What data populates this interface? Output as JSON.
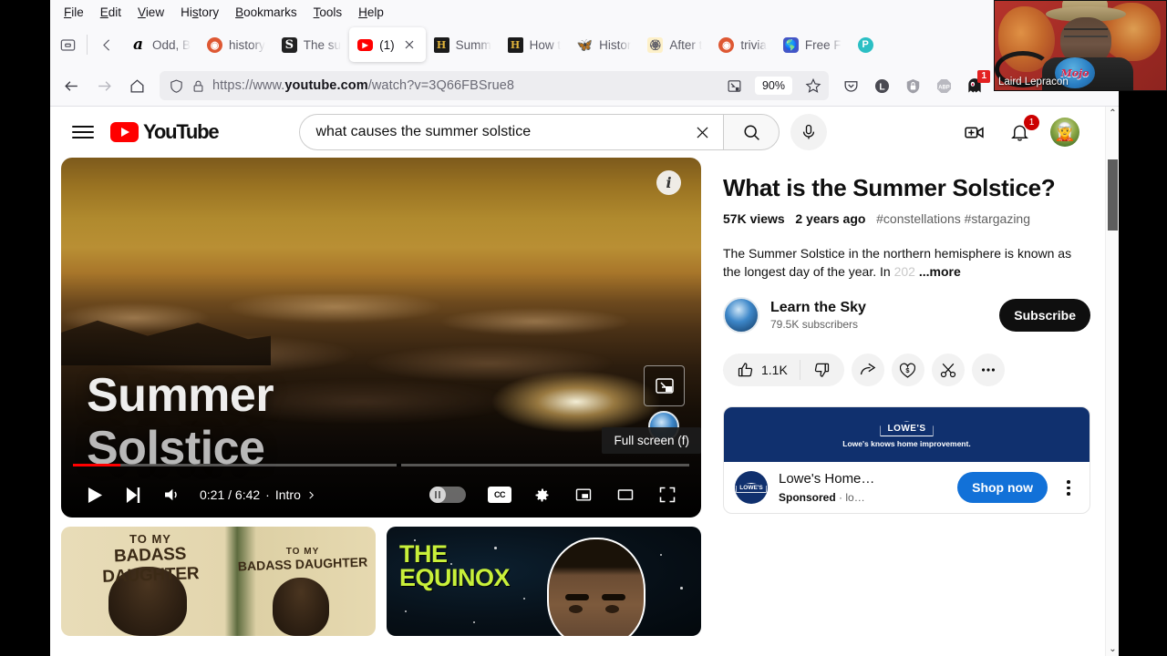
{
  "browser": {
    "menu_items": [
      "File",
      "Edit",
      "View",
      "History",
      "Bookmarks",
      "Tools",
      "Help"
    ],
    "tabs": [
      {
        "label": "Odd, B",
        "icon": "amazon-icon",
        "active": false
      },
      {
        "label": "history",
        "icon": "duckduckgo-icon",
        "active": false
      },
      {
        "label": "The su",
        "icon": "scribd-icon",
        "active": false
      },
      {
        "label": "(1)",
        "icon": "youtube-icon",
        "active": true
      },
      {
        "label": "Summ",
        "icon": "history-channel-icon",
        "active": false
      },
      {
        "label": "How t",
        "icon": "history-channel-icon",
        "active": false
      },
      {
        "label": "Histor",
        "icon": "butterfly-icon",
        "active": false
      },
      {
        "label": "After t",
        "icon": "afterlife-icon",
        "active": false
      },
      {
        "label": "trivia",
        "icon": "duckduckgo-icon",
        "active": false
      },
      {
        "label": "Free F",
        "icon": "globe-icon",
        "active": false
      },
      {
        "label": "",
        "icon": "p-icon",
        "active": false
      }
    ],
    "url": "https://www.youtube.com/watch?v=3Q66FBSrue8",
    "url_domain": "youtube.com",
    "url_prefix": "https://www.",
    "url_suffix": "/watch?v=3Q66FBSrue8",
    "zoom_level": "90%",
    "extension_badge_count": "1",
    "extensions": [
      "pocket-icon",
      "lastpass-icon",
      "privacy-badger-icon",
      "abp-icon",
      "ghostery-icon",
      "shoe-icon",
      "puzzle-extensions-icon",
      "overflow-chevrons-icon",
      "app-menu-icon"
    ]
  },
  "webcam": {
    "name": "Laird Lepracon"
  },
  "youtube": {
    "logo_text": "YouTube",
    "search": {
      "value": "what causes the summer solstice",
      "placeholder": "Search"
    },
    "notification_count": "1",
    "header_icons": [
      "guide-menu-icon",
      "voice-search-icon",
      "create-video-icon",
      "notifications-bell-icon",
      "account-avatar"
    ]
  },
  "player": {
    "title_line1": "Summer",
    "title_line2": "Solstice",
    "current_time": "0:21",
    "duration": "6:42",
    "separator": "·",
    "chapter": "Intro",
    "tooltip": "Full screen (f)",
    "time_display": "0:21 / 6:42",
    "controls": [
      "play-button",
      "next-button",
      "volume-button",
      "autoplay-toggle",
      "subtitles-button",
      "settings-button",
      "miniplayer-button",
      "theater-button",
      "fullscreen-button"
    ],
    "cc_label": "CC",
    "progress_percent": 5.2
  },
  "video": {
    "title": "What is the Summer Solstice?",
    "views": "57K views",
    "age": "2 years ago",
    "tags": "#constellations #stargazing",
    "description_line1": "The Summer Solstice in the northern hemisphere is",
    "description_line2": "known as the longest day of the year. In ",
    "description_fade": "202",
    "more_label": "...more"
  },
  "channel": {
    "name": "Learn the Sky",
    "subscribers": "79.5K subscribers",
    "subscribe_label": "Subscribe"
  },
  "actions": {
    "like_count": "1.1K",
    "buttons": [
      "like-button",
      "dislike-button",
      "share-button",
      "thanks-button",
      "clip-button",
      "more-actions-button"
    ]
  },
  "ad": {
    "banner_logo": "LOWE'S",
    "banner_tagline": "Lowe's knows home improvement.",
    "advertiser": "Lowe's Home…",
    "sponsored_label": "Sponsored",
    "sponsored_sep": "·",
    "sponsored_site": "lo…",
    "cta_label": "Shop now"
  },
  "thumbnails": [
    {
      "name": "badass-daughter-blanket",
      "text_small": "TO MY",
      "text_large": "BADASS DAUGHTER",
      "text_small2": "TO MY",
      "text_large2": "BADASS DAUGHTER"
    },
    {
      "name": "the-equinox-video",
      "text_line1": "THE",
      "text_line2": "EQUINOX"
    }
  ]
}
